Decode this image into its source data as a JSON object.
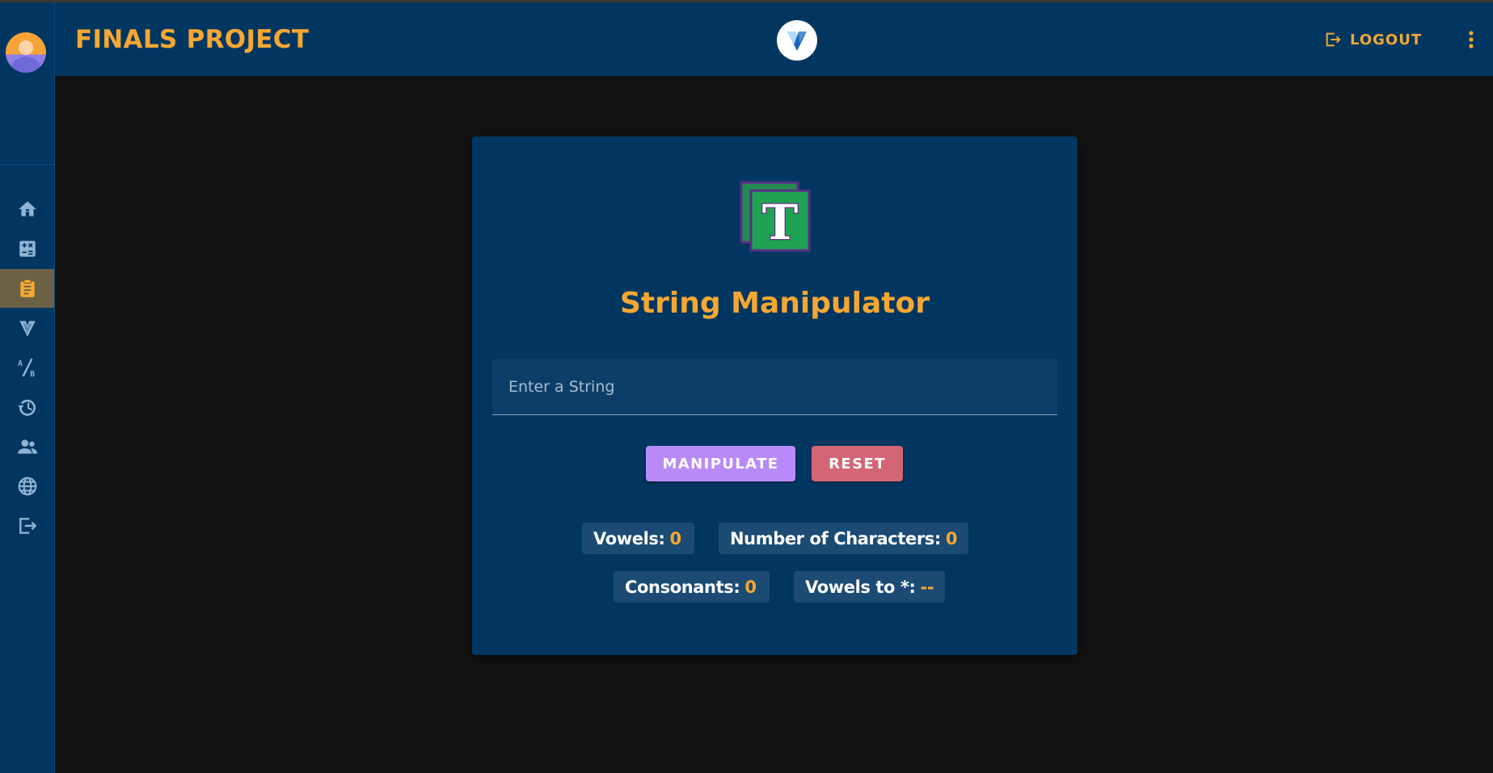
{
  "app": {
    "title": "FINALS PROJECT",
    "logout_label": "LOGOUT",
    "accent_color": "#f5a733",
    "primary_color": "#003660"
  },
  "sidebar": {
    "items": [
      {
        "icon": "home-icon",
        "active": false
      },
      {
        "icon": "calculator-icon",
        "active": false
      },
      {
        "icon": "clipboard-icon",
        "active": true
      },
      {
        "icon": "vuetify-icon",
        "active": false
      },
      {
        "icon": "ab-testing-icon",
        "active": false
      },
      {
        "icon": "history-icon",
        "active": false
      },
      {
        "icon": "users-icon",
        "active": false
      },
      {
        "icon": "globe-icon",
        "active": false
      },
      {
        "icon": "logout-icon",
        "active": false
      }
    ]
  },
  "card": {
    "heading": "String Manipulator",
    "input": {
      "placeholder": "Enter a String",
      "value": ""
    },
    "buttons": {
      "manipulate": "MANIPULATE",
      "reset": "RESET"
    },
    "stats": {
      "vowels_label": "Vowels:",
      "vowels_value": "0",
      "chars_label": "Number of Characters:",
      "chars_value": "0",
      "consonants_label": "Consonants:",
      "consonants_value": "0",
      "vowels_to_star_label": "Vowels to *:",
      "vowels_to_star_value": "--"
    }
  }
}
